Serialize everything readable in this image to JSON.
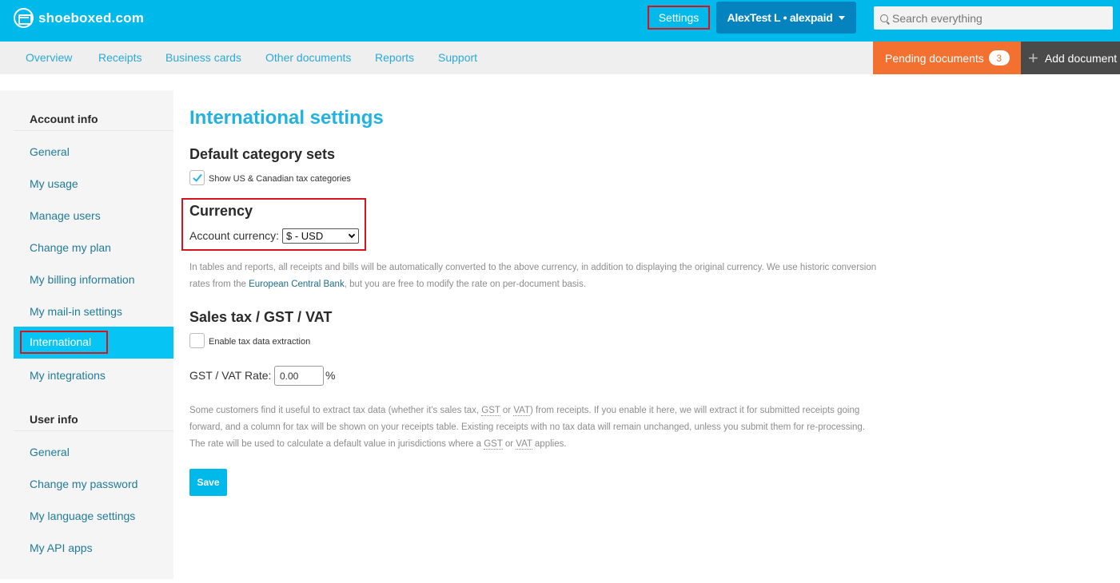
{
  "header": {
    "logo_text": "shoeboxed.com",
    "settings_label": "Settings",
    "user_menu_label": "AlexTest L • alexpaid",
    "search_placeholder": "Search everything"
  },
  "nav": {
    "items": [
      "Overview",
      "Receipts",
      "Business cards",
      "Other documents",
      "Reports",
      "Support"
    ],
    "pending_label": "Pending documents",
    "pending_count": "3",
    "add_label": "Add document"
  },
  "sidebar": {
    "account_header": "Account info",
    "account_items": [
      "General",
      "My usage",
      "Manage users",
      "Change my plan",
      "My billing information",
      "My mail-in settings",
      "International",
      "My integrations"
    ],
    "active_item": "International",
    "user_header": "User info",
    "user_items": [
      "General",
      "Change my password",
      "My language settings",
      "My API apps"
    ]
  },
  "main": {
    "title": "International settings",
    "category_heading": "Default category sets",
    "category_checkbox_label": "Show US & Canadian tax categories",
    "category_checked": true,
    "currency_heading": "Currency",
    "currency_label": "Account currency:",
    "currency_value": "$ - USD",
    "currency_help_1": "In tables and reports, all receipts and bills will be automatically converted to the above currency, in addition to displaying the original currency. We use historic conversion rates from the ",
    "currency_help_link": "European Central Bank",
    "currency_help_2": ", but you are free to modify the rate on per-document basis.",
    "tax_heading": "Sales tax / GST / VAT",
    "tax_checkbox_label": "Enable tax data extraction",
    "tax_checked": false,
    "rate_label": "GST / VAT Rate:",
    "rate_value": "0.00",
    "rate_unit": "%",
    "tax_help_1": "Some customers find it useful to extract tax data (whether it's sales tax, ",
    "abbr_gst": "GST",
    "tax_help_or": " or ",
    "abbr_vat": "VAT",
    "tax_help_2": ") from receipts. If you enable it here, we will extract it for submitted receipts going forward, and a column for tax will be shown on your receipts table. Existing receipts with no tax data will remain unchanged, unless you submit them for re-processing. The rate will be used to calculate a default value in jurisdictions where a ",
    "tax_help_3": " applies.",
    "save_label": "Save"
  },
  "colors": {
    "brand": "#00b9eb",
    "pending": "#f37130",
    "highlight": "#d9131b"
  }
}
